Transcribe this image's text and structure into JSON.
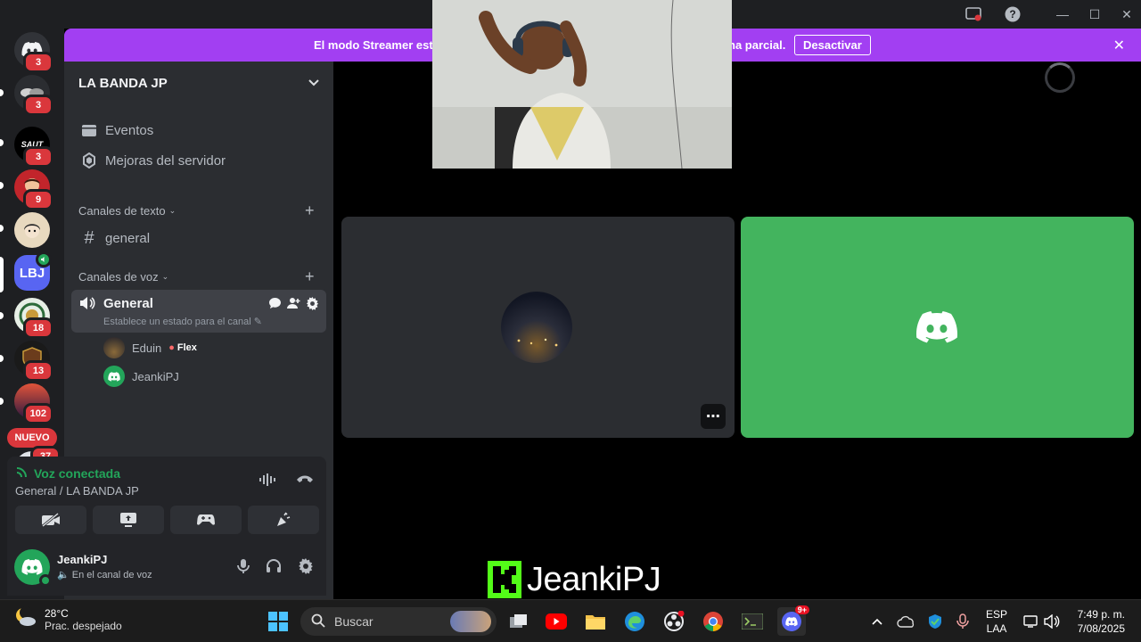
{
  "banner": {
    "message_left": "El modo Streamer esta",
    "message_right": "na parcial.",
    "button": "Desactivar"
  },
  "rail": {
    "servers": [
      {
        "abbr": "",
        "badge": "3"
      },
      {
        "abbr": "",
        "badge": "3"
      },
      {
        "abbr": "SAUT",
        "badge": "3"
      },
      {
        "abbr": "",
        "badge": "9"
      },
      {
        "abbr": "",
        "badge": ""
      },
      {
        "abbr": "LBJ",
        "badge": ""
      },
      {
        "abbr": "",
        "badge": "18"
      },
      {
        "abbr": "",
        "badge": "13"
      },
      {
        "abbr": "",
        "badge": "102"
      }
    ],
    "new_label": "NUEVO",
    "partial_badge": "37"
  },
  "sidebar": {
    "server_name": "LA BANDA JP",
    "nav": [
      {
        "label": "Eventos"
      },
      {
        "label": "Mejoras del servidor"
      }
    ],
    "text_category": "Canales de texto",
    "text_channel": "general",
    "voice_category": "Canales de voz",
    "voice_channel": {
      "name": "General",
      "status": "Establece un estado para el canal"
    },
    "members": [
      {
        "name": "Eduin",
        "tag": "Flex"
      },
      {
        "name": "JeankiPJ",
        "tag": ""
      }
    ]
  },
  "voice_panel": {
    "status": "Voz conectada",
    "location": "General / LA BANDA JP"
  },
  "user_panel": {
    "name": "JeankiPJ",
    "status": "En el canal de voz"
  },
  "overlay": {
    "brand_text": "JeankiPJ"
  },
  "taskbar": {
    "temperature": "28°C",
    "condition": "Prac. despejado",
    "search_placeholder": "Buscar",
    "lang_top": "ESP",
    "lang_bottom": "LAA",
    "time": "7:49 p. m.",
    "date": "7/08/2025",
    "discord_badge": "9+"
  },
  "colors": {
    "banner": "#a23ff2",
    "voice_green": "#23a55a",
    "tile_green": "#43b45e",
    "badge_red": "#da373c",
    "kick_green": "#53fc18"
  }
}
